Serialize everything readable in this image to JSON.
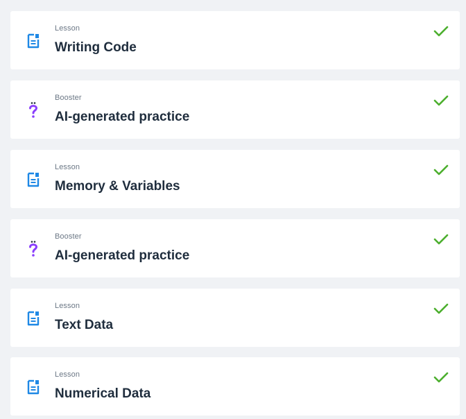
{
  "colors": {
    "lesson_icon": "#1e88e5",
    "booster_icon": "#8a3ffc",
    "check": "#4caf2e",
    "title_text": "#1f2d3d",
    "kind_text": "#6b7785",
    "page_background": "#f0f2f5"
  },
  "items": [
    {
      "kind": "Lesson",
      "title": "Writing Code",
      "icon": "document-icon",
      "completed": true
    },
    {
      "kind": "Booster",
      "title": "AI-generated practice",
      "icon": "question-mark-icon",
      "completed": true
    },
    {
      "kind": "Lesson",
      "title": "Memory & Variables",
      "icon": "document-icon",
      "completed": true
    },
    {
      "kind": "Booster",
      "title": "AI-generated practice",
      "icon": "question-mark-icon",
      "completed": true
    },
    {
      "kind": "Lesson",
      "title": "Text Data",
      "icon": "document-icon",
      "completed": true
    },
    {
      "kind": "Lesson",
      "title": "Numerical Data",
      "icon": "document-icon",
      "completed": true
    }
  ]
}
